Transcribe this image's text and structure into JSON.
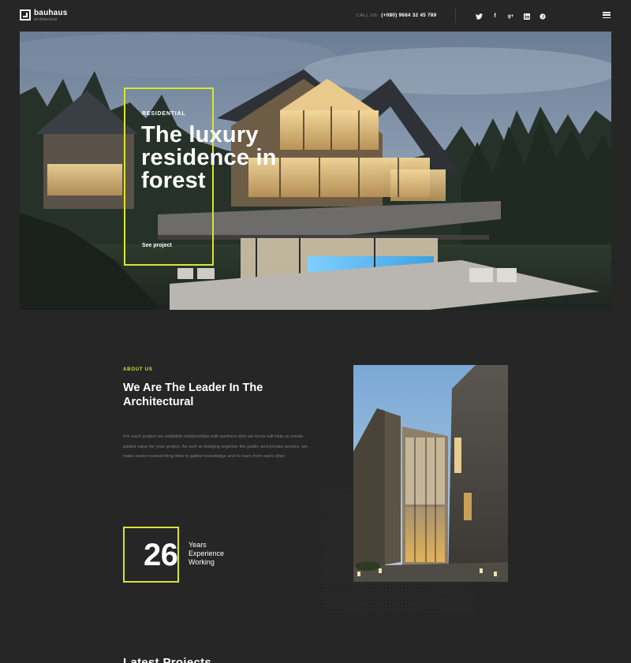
{
  "brand": {
    "name": "bauhaus",
    "tagline": "architecture"
  },
  "header": {
    "call_label": "CALL US:",
    "phone": "(+080) 9684 32 45 789",
    "social": [
      {
        "icon": "twitter-icon",
        "glyph": "🐦"
      },
      {
        "icon": "facebook-icon",
        "glyph": "f"
      },
      {
        "icon": "google-plus-icon",
        "glyph": "g+"
      },
      {
        "icon": "linkedin-icon",
        "glyph": "in"
      },
      {
        "icon": "pinterest-icon",
        "glyph": "℗"
      }
    ],
    "menu_icon": "hamburger-menu-icon"
  },
  "hero": {
    "category": "RESIDENTIAL",
    "title": "The luxury residence in forest",
    "link": "See project"
  },
  "about": {
    "label": "ABOUT US",
    "title": "We Are The Leader In The Architectural",
    "text": "For each project we establish relationships with partners who we know will help us create added value for your project. As well as bringing together the public and private sectors, we make sector-overarching links to gather knowledge and to learn from each other",
    "stat_number": "26",
    "stat_label": "Years Experience Working"
  },
  "latest": {
    "title": "Latest Projects"
  },
  "colors": {
    "accent": "#d8e530",
    "background": "#262626"
  }
}
